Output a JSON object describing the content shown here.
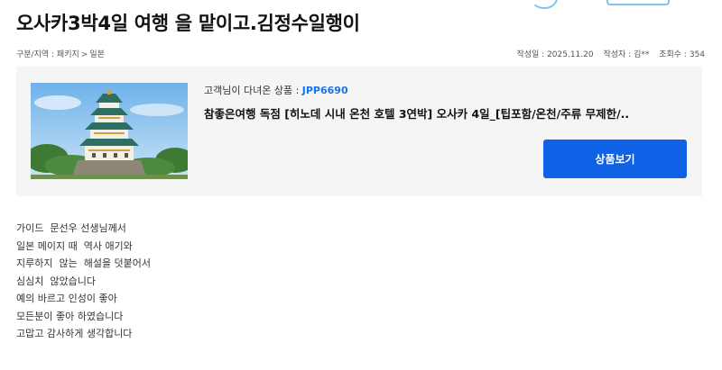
{
  "title": "오사카3박4일 여행 을 맡이고.김정수일행이",
  "breadcrumb": {
    "label": "구분/지역 : ",
    "items": [
      "패키지",
      "일본"
    ],
    "separator": ">"
  },
  "meta": {
    "date": "작성일 : 2025.11.20",
    "author": "작성자 : 김**",
    "views": "조회수 : 354"
  },
  "product": {
    "code_label": "고객님이 다녀온 상품 : ",
    "code": "JPP6690",
    "name": "참좋은여행 독점 [히노데 시내 온천 호텔 3연박] 오사카 4일_[팁포함/온천/주류 무제한/..",
    "button_label": "상품보기",
    "image_icon": "osaka-castle-photo"
  },
  "review": {
    "lines": [
      "가이드  문선우 선생님께서",
      "일본 메이지 때  역사 애기와",
      "지루하지  않는  해설을 덧붙어서",
      "심심치  않았습니다",
      "예의 바르고 인성이 좋아",
      "모든분이 좋아 하였습니다",
      "고맙고 감사하게 생각합니다"
    ]
  },
  "colors": {
    "accent": "#0f62e6",
    "code": "#1a73e8",
    "box_bg": "#f5f5f5"
  }
}
